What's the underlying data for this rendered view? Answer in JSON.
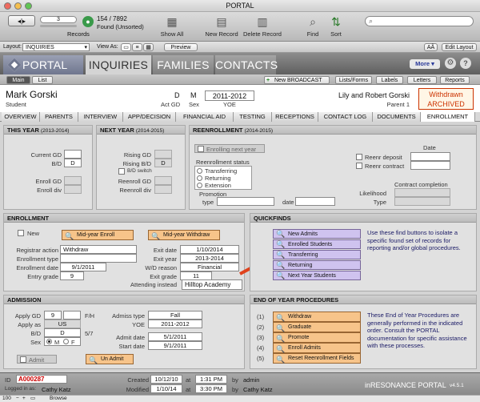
{
  "window": {
    "title": "PORTAL"
  },
  "toolbar": {
    "record_number": "3",
    "found_count": "154 / 7892",
    "found_label": "Found (Unsorted)",
    "records_label": "Records",
    "show_all": "Show All",
    "new_record": "New Record",
    "delete_record": "Delete Record",
    "find": "Find",
    "sort": "Sort",
    "search_placeholder": ""
  },
  "layoutbar": {
    "layout_label": "Layout:",
    "layout_value": "INQUIRIES",
    "view_as_label": "View As:",
    "preview": "Preview",
    "aa": "AÂ",
    "edit_layout": "Edit Layout"
  },
  "header": {
    "app_name": "PORTAL",
    "tabs": [
      "INQUIRIES",
      "FAMILIES",
      "CONTACTS"
    ],
    "more": "More",
    "sub_tabs": [
      "Main",
      "List"
    ],
    "new_broadcast": "New BROADCAST",
    "actions": [
      "Lists/Forms",
      "Labels",
      "Letters",
      "Reports"
    ]
  },
  "student": {
    "name": "Mark Gorski",
    "name_label": "Student",
    "act_gd": "D",
    "act_gd_label": "Act GD",
    "sex": "M",
    "sex_label": "Sex",
    "yoe": "2011-2012",
    "yoe_label": "YOE",
    "parents": "Lily and Robert Gorski",
    "parent_label": "Parent 1",
    "status_line1": "Withdrawn",
    "status_line2": "ARCHIVED"
  },
  "tabs": [
    "OVERVIEW",
    "PARENTS",
    "INTERVIEW",
    "APP/DECISION",
    "FINANCIAL AID",
    "TESTING",
    "RECEPTIONS",
    "CONTACT LOG",
    "DOCUMENTS",
    "ENROLLMENT"
  ],
  "this_year": {
    "title": "THIS YEAR",
    "range": "(2013-2014)",
    "current_gd_label": "Current GD",
    "bd_label": "B/D",
    "bd_value": "D",
    "enroll_gd_label": "Enroll GD",
    "enroll_div_label": "Enroll div"
  },
  "next_year": {
    "title": "NEXT YEAR",
    "range": "(2014-2015)",
    "rising_gd_label": "Rising GD",
    "rising_bd_label": "Rising B/D",
    "rising_bd_value": "D",
    "bd_switch_label": "B/D switch",
    "reenroll_gd_label": "Reenroll GD",
    "reenroll_div_label": "Reenroll div"
  },
  "reenrollment": {
    "title": "REENROLLMENT",
    "range": "(2014-2015)",
    "enrolling_next_year": "Enrolling next year",
    "status_label": "Reenrollment status",
    "options": [
      "Transferring",
      "Returning",
      "Extension"
    ],
    "promotion_label": "Promotion",
    "type_label": "type",
    "date_label": "date",
    "date_col": "Date",
    "reenr_deposit": "Reenr deposit",
    "reenr_contract": "Reenr contract",
    "contract_completion": "Contract completion",
    "likelihood": "Likelihood",
    "type2": "Type"
  },
  "enrollment": {
    "title": "ENROLLMENT",
    "new_label": "New",
    "mid_year_enroll": "Mid-year Enroll",
    "mid_year_withdraw": "Mid-year Withdraw",
    "registrar_action_label": "Registrar action",
    "registrar_action": "Withdraw",
    "enrollment_type_label": "Enrollment type",
    "enrollment_type": "",
    "enrollment_date_label": "Enrollment date",
    "enrollment_date": "9/1/2011",
    "entry_grade_label": "Entry grade",
    "entry_grade": "9",
    "exit_date_label": "Exit date",
    "exit_date": "1/10/2014",
    "exit_year_label": "Exit year",
    "exit_year": "2013-2014",
    "wd_reason_label": "W/D reason",
    "wd_reason": "Financial",
    "exit_grade_label": "Exit grade",
    "exit_grade": "11",
    "attending_instead_label": "Attending instead",
    "attending_instead": "Hilltop Academy"
  },
  "quickfinds": {
    "title": "QUICKFINDS",
    "buttons": [
      "New Admits",
      "Enrolled Students",
      "Transferring",
      "Returning",
      "Next Year Students"
    ],
    "info": "Use these find buttons to isolate a specific found set of records for reporting and/or global procedures."
  },
  "admission": {
    "title": "ADMISSION",
    "apply_gd_label": "Apply GD",
    "apply_gd": "9",
    "fh_label": "F/H",
    "apply_as_label": "Apply as",
    "apply_as": "US",
    "bd_label": "B/D",
    "bd_value": "D",
    "ratio": "5/7",
    "sex_label": "Sex",
    "sex_options": [
      "M",
      "F"
    ],
    "admiss_type_label": "Admiss type",
    "admiss_type": "Fall",
    "yoe_label": "YOE",
    "yoe": "2011-2012",
    "admit_date_label": "Admit date",
    "admit_date": "5/1/2011",
    "start_date_label": "Start date",
    "start_date": "9/1/2011",
    "admit_label": "Admit",
    "unadmit": "Un Admit"
  },
  "end_of_year": {
    "title": "END OF YEAR PROCEDURES",
    "numbers": [
      "(1)",
      "(2)",
      "(3)",
      "(4)",
      "(5)"
    ],
    "buttons": [
      "Withdraw",
      "Graduate",
      "Promote",
      "Enroll Admits",
      "Reset Reenrollment Fields"
    ],
    "info": "These End of Year Procedures are generally performed in the indicated order. Consult the PORTAL documentation for specific assistance with these processes."
  },
  "footer": {
    "id_label": "ID",
    "id_value": "A000287",
    "logged_in_label": "Logged in as:",
    "logged_in_user": "Cathy Katz",
    "created_label": "Created",
    "created_date": "10/12/10",
    "created_at": "at",
    "created_time": "1:31 PM",
    "created_by": "by",
    "created_user": "admin",
    "modified_label": "Modified",
    "modified_date": "1/10/14",
    "modified_at": "at",
    "modified_time": "3:30 PM",
    "modified_by": "by",
    "modified_user": "Cathy Katz",
    "brand": "inRESONANCE PORTAL",
    "version": "v4.5.1"
  },
  "statusbar": {
    "zoom": "100",
    "mode": "Browse"
  }
}
